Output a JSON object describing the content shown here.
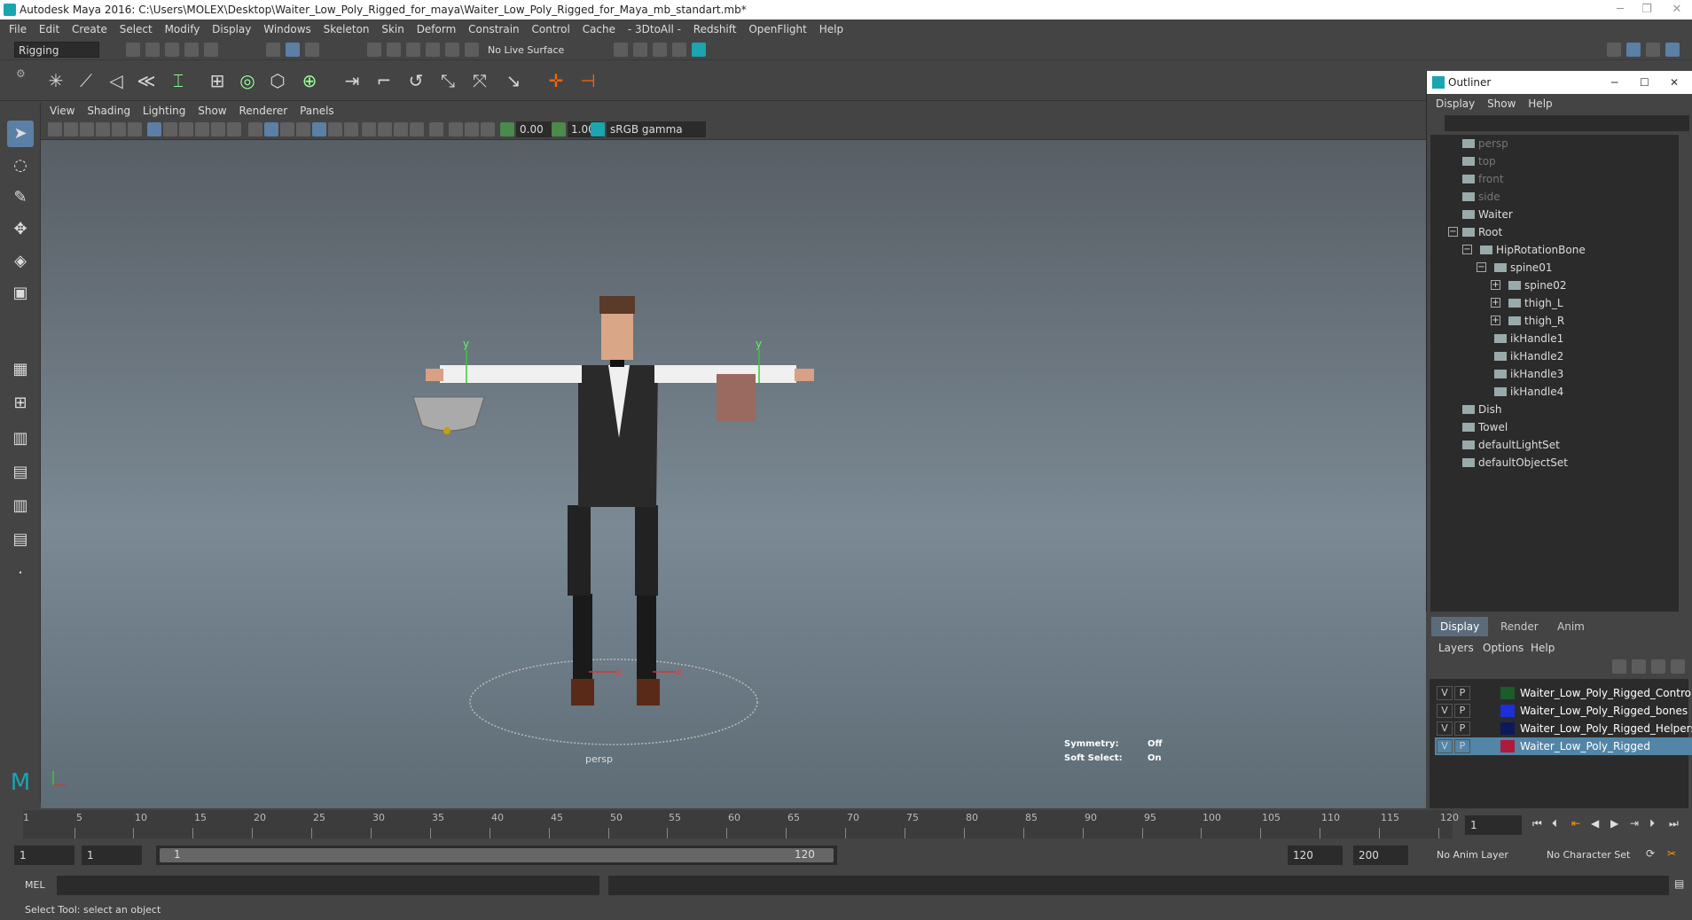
{
  "window": {
    "title": "Autodesk Maya 2016: C:\\Users\\MOLEX\\Desktop\\Waiter_Low_Poly_Rigged_for_maya\\Waiter_Low_Poly_Rigged_for_Maya_mb_standart.mb*"
  },
  "menu": [
    "File",
    "Edit",
    "Create",
    "Select",
    "Modify",
    "Display",
    "Windows",
    "Skeleton",
    "Skin",
    "Deform",
    "Constrain",
    "Control",
    "Cache",
    "- 3DtoAll -",
    "Redshift",
    "OpenFlight",
    "Help"
  ],
  "status": {
    "menuset": "Rigging",
    "live_surface": "No Live Surface"
  },
  "viewport": {
    "menu": [
      "View",
      "Shading",
      "Lighting",
      "Show",
      "Renderer",
      "Panels"
    ],
    "near_value": "0.00",
    "far_value": "1.00",
    "colorspace": "sRGB gamma",
    "camera_label": "persp",
    "symmetry_label": "Symmetry:",
    "symmetry_value": "Off",
    "softselect_label": "Soft Select:",
    "softselect_value": "On",
    "axis_y": "y",
    "axis_x": "x"
  },
  "outliner": {
    "title": "Outliner",
    "menu": [
      "Display",
      "Show",
      "Help"
    ],
    "nodes": [
      "persp",
      "top",
      "front",
      "side",
      "Waiter",
      "Root",
      "HipRotationBone",
      "spine01",
      "spine02",
      "thigh_L",
      "thigh_R",
      "ikHandle1",
      "ikHandle2",
      "ikHandle3",
      "ikHandle4",
      "Dish",
      "Towel",
      "defaultLightSet",
      "defaultObjectSet"
    ]
  },
  "layers": {
    "tabs": [
      "Display",
      "Render",
      "Anim"
    ],
    "menu": [
      "Layers",
      "Options",
      "Help"
    ],
    "rows": [
      {
        "v": "V",
        "p": "P",
        "name": "Waiter_Low_Poly_Rigged_Controllers",
        "color": "#1a5c2a"
      },
      {
        "v": "V",
        "p": "P",
        "name": "Waiter_Low_Poly_Rigged_bones",
        "color": "#1d2fd8"
      },
      {
        "v": "V",
        "p": "P",
        "name": "Waiter_Low_Poly_Rigged_Helpers",
        "color": "#0b1a5a"
      },
      {
        "v": "V",
        "p": "P",
        "name": "Waiter_Low_Poly_Rigged",
        "color": "#b01a3a"
      }
    ]
  },
  "timeline": {
    "ticks": [
      "5",
      "10",
      "15",
      "20",
      "25",
      "30",
      "35",
      "40",
      "45",
      "50",
      "55",
      "60",
      "65",
      "70",
      "75",
      "80",
      "85",
      "90",
      "95",
      "100",
      "105",
      "110",
      "115",
      "120"
    ],
    "start": "1",
    "current_frame": "1"
  },
  "range": {
    "start": "1",
    "playback_start": "1",
    "slider_start": "1",
    "slider_end": "120",
    "playback_end": "120",
    "end": "200",
    "anim_layer": "No Anim Layer",
    "character_set": "No Character Set"
  },
  "command": {
    "label": "MEL"
  },
  "help": {
    "text": "Select Tool: select an object"
  }
}
